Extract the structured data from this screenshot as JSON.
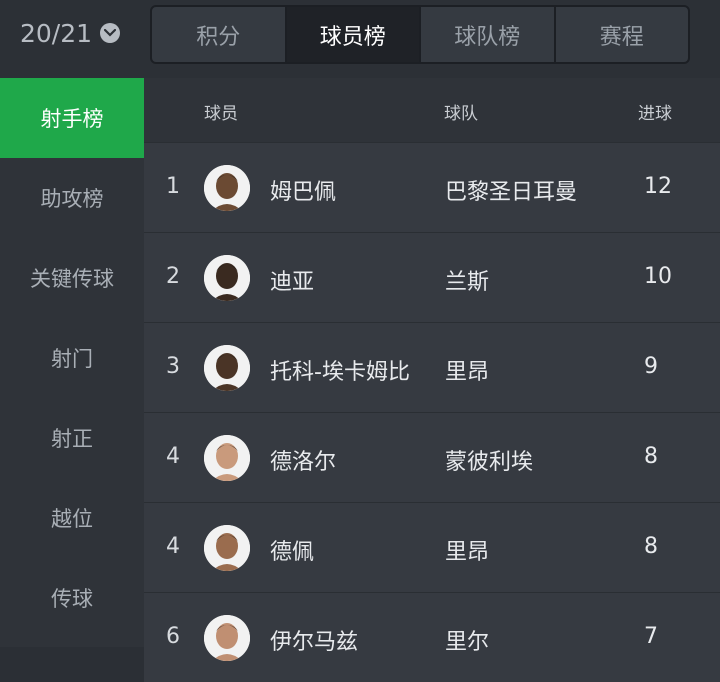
{
  "season": {
    "label": "20/21"
  },
  "tabs": [
    {
      "label": "积分"
    },
    {
      "label": "球员榜"
    },
    {
      "label": "球队榜"
    },
    {
      "label": "赛程"
    }
  ],
  "sidebar": {
    "items": [
      {
        "label": "射手榜"
      },
      {
        "label": "助攻榜"
      },
      {
        "label": "关键传球"
      },
      {
        "label": "射门"
      },
      {
        "label": "射正"
      },
      {
        "label": "越位"
      },
      {
        "label": "传球"
      }
    ]
  },
  "table": {
    "headers": {
      "player": "球员",
      "team": "球队",
      "goals": "进球"
    },
    "rows": [
      {
        "rank": "1",
        "name": "姆巴佩",
        "team": "巴黎圣日耳曼",
        "goals": "12",
        "skin": "#6b4a33"
      },
      {
        "rank": "2",
        "name": "迪亚",
        "team": "兰斯",
        "goals": "10",
        "skin": "#3a2a20"
      },
      {
        "rank": "3",
        "name": "托科-埃卡姆比",
        "team": "里昂",
        "goals": "9",
        "skin": "#4a3426"
      },
      {
        "rank": "4",
        "name": "德洛尔",
        "team": "蒙彼利埃",
        "goals": "8",
        "skin": "#c99a7c"
      },
      {
        "rank": "4",
        "name": "德佩",
        "team": "里昂",
        "goals": "8",
        "skin": "#9a6c4e"
      },
      {
        "rank": "6",
        "name": "伊尔马兹",
        "team": "里尔",
        "goals": "7",
        "skin": "#c08f72"
      }
    ]
  },
  "colors": {
    "accent": "#1fa84a",
    "background": "#2b2f35"
  }
}
